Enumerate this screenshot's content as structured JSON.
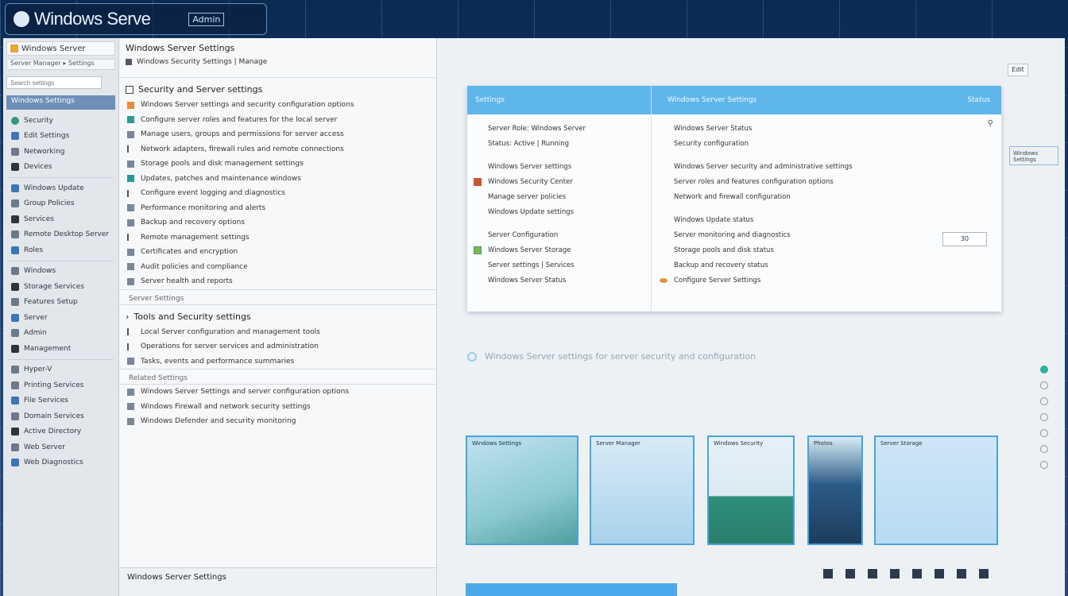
{
  "window": {
    "title": "Windows Serve",
    "badge": "Admin"
  },
  "nav": {
    "tab_label": "Windows Server",
    "path": "Server Manager ▸ Settings",
    "search_placeholder": "Search settings",
    "selected": "Windows Settings",
    "items": [
      {
        "label": "Security",
        "icon": "shield-icon"
      },
      {
        "label": "Edit Settings",
        "icon": "edit-icon"
      },
      {
        "label": "Networking",
        "icon": "network-icon"
      },
      {
        "label": "Devices",
        "icon": "devices-icon"
      },
      {
        "label": "Windows Update",
        "icon": "update-icon"
      },
      {
        "label": "Group Policies",
        "icon": "policy-icon"
      },
      {
        "label": "Services",
        "icon": "services-icon"
      },
      {
        "label": "Remote Desktop Server",
        "icon": "remote-icon"
      },
      {
        "label": "Roles",
        "icon": "roles-icon"
      },
      {
        "label": "Windows",
        "icon": "windows-icon"
      },
      {
        "label": "Storage Services",
        "icon": "storage-icon"
      },
      {
        "label": "Features Setup",
        "icon": "features-icon"
      },
      {
        "label": "Server",
        "icon": "server-icon"
      },
      {
        "label": "Admin",
        "icon": "admin-icon"
      },
      {
        "label": "Management",
        "icon": "management-icon"
      },
      {
        "label": "Hyper-V",
        "icon": "hyperv-icon"
      },
      {
        "label": "Printing Services",
        "icon": "printer-icon"
      },
      {
        "label": "File Services",
        "icon": "file-icon"
      },
      {
        "label": "Domain Services",
        "icon": "domain-icon"
      },
      {
        "label": "Active Directory",
        "icon": "directory-icon"
      },
      {
        "label": "Web Server",
        "icon": "web-icon"
      },
      {
        "label": "Web Diagnostics",
        "icon": "diagnostics-icon"
      }
    ]
  },
  "middle": {
    "title": "Windows Server Settings",
    "sub": "Windows Security Settings | Manage",
    "section1_title": "Security and Server settings",
    "section1_rows": [
      "Windows Server settings and security configuration options",
      "Configure server roles and features for the local server",
      "Manage users, groups and permissions for server access",
      "Network adapters, firewall rules and remote connections",
      "Storage pools and disk management settings",
      "Updates, patches and maintenance windows",
      "Configure event logging and diagnostics",
      "Performance monitoring and alerts",
      "Backup and recovery options",
      "Remote management settings",
      "Certificates and encryption",
      "Audit policies and compliance",
      "Server health and reports"
    ],
    "subsection_label": "Server Settings",
    "section2_title": "Tools and Security settings",
    "section2_rows": [
      "Local Server configuration and management tools",
      "Operations for server services and administration",
      "Tasks, events and performance summaries"
    ],
    "subsection2_label": "Related Settings",
    "section3_rows": [
      "Windows Server Settings and server configuration options",
      "Windows Firewall and network security settings",
      "Windows Defender and security monitoring"
    ],
    "footer": "Windows Server Settings"
  },
  "panel": {
    "head_left": "Settings",
    "head_right_a": "Windows Server Settings",
    "head_right_b": "Status",
    "left_rows": [
      "Server Role: Windows Server",
      "Status: Active | Running",
      "Windows Server settings",
      "Windows Security Center",
      "Manage server policies",
      "Windows Update settings",
      "Server Configuration",
      "Windows Server Storage",
      "Server settings | Services",
      "Windows Server Status"
    ],
    "right_rows": [
      "Windows Server Status",
      "Security configuration",
      "Windows Server security and administrative settings",
      "Server roles and features configuration options",
      "Network and firewall configuration",
      "Windows Update status",
      "Server monitoring and diagnostics",
      "Storage pools and disk status",
      "Backup and recovery status",
      "Configure Server Settings"
    ],
    "field_value": "30",
    "top_button": "Edit"
  },
  "status_text": "Windows Server settings for server security and configuration",
  "thumbnails": [
    "Windows Settings",
    "Server Manager",
    "Windows Security",
    "Photos",
    "Server Storage"
  ],
  "widget": "Windows Settings"
}
